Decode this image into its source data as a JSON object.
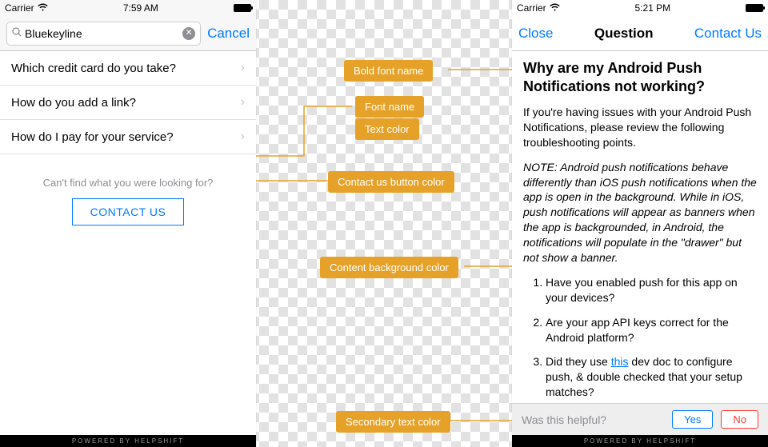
{
  "left": {
    "status": {
      "carrier": "Carrier",
      "time": "7:59 AM"
    },
    "search": {
      "value": "Bluekeyline",
      "cancel": "Cancel"
    },
    "rows": [
      "Which credit card do you take?",
      "How do you add a link?",
      "How do I pay for your service?"
    ],
    "prompt": "Can't find what you were looking for?",
    "contact": "CONTACT US",
    "powered": "POWERED BY HELPSHIFT"
  },
  "right": {
    "status": {
      "carrier": "Carrier",
      "time": "5:21 PM"
    },
    "nav": {
      "close": "Close",
      "title": "Question",
      "contact": "Contact Us"
    },
    "article": {
      "title": "Why are my Android Push Notifications not working?",
      "intro": "If you're having issues with your Android Push Notifications, please review the following troubleshooting points.",
      "note": "NOTE: Android push notifications behave differently than iOS push notifications when the app is open in the background. While in iOS, push notifications will appear as banners when the app is backgrounded, in Android, the notifications will populate in the \"drawer\" but not show a banner.",
      "ol": [
        "Have you enabled push for this app on your devices?",
        "Are your app API keys correct for the Android platform?",
        {
          "pre": "Did they use ",
          "link": "this",
          "post": " dev doc to configure push, & double checked that your setup matches?"
        }
      ]
    },
    "helpful": {
      "q": "Was this helpful?",
      "yes": "Yes",
      "no": "No"
    },
    "powered": "POWERED BY HELPSHIFT"
  },
  "annotations": {
    "bold_font": "Bold font name",
    "font_name": "Font name",
    "text_color": "Text color",
    "contact_color": "Contact us button color",
    "bg_color": "Content background color",
    "secondary": "Secondary text color"
  }
}
